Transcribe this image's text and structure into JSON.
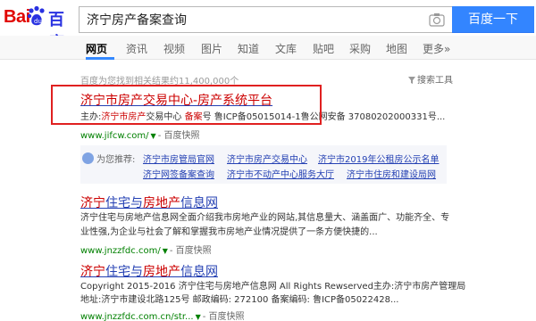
{
  "brand": {
    "logo_left": "Bai",
    "logo_right": "百度"
  },
  "search": {
    "query": "济宁房产备案查询",
    "button": "百度一下"
  },
  "tabs": [
    "网页",
    "资讯",
    "视频",
    "图片",
    "知道",
    "文库",
    "贴吧",
    "采购",
    "地图",
    "更多»"
  ],
  "result_count": "百度为您找到相关结果约11,400,000个",
  "tools": "搜索工具",
  "results": [
    {
      "title_a": "济宁市房产交易中心",
      "title_b": "-房产系统平台",
      "abstract_1_a": "主办:",
      "abstract_1_b": "济宁市房产",
      "abstract_1_c": "交易中心 ",
      "abstract_1_d": "备案",
      "abstract_1_e": "号 鲁ICP备05015014-1鲁公网安备 37080202000331号...",
      "url": "www.jifcw.com/",
      "snapshot": "- 百度快照"
    },
    {
      "title_a": "济宁",
      "title_b": "住宅与",
      "title_c": "房地产",
      "title_d": "信息网",
      "abstract_1": "济宁住宅与房地产信息网全面介绍我市房地产业的网站,其信息量大、涵盖面广、功能齐全、专",
      "abstract_2": "业性强,为企业与社会了解和掌握我市房地产业情况提供了一条方便快捷的...",
      "url": "www.jnzzfdc.com/",
      "snapshot": "- 百度快照"
    },
    {
      "title_a": "济宁",
      "title_b": "住宅与",
      "title_c": "房地产",
      "title_d": "信息网",
      "abstract_1": "Copyright 2015-2016 济宁住宅与房地产信息网 All Rights Rewserved主办:济宁市房产管理局",
      "abstract_2": "地址:济宁市建设北路125号 邮政编码: 272100 备案编码: 鲁ICP备05022428...",
      "url": "www.jnzzfdc.com.cn/str...",
      "snapshot": "- 百度快照"
    }
  ],
  "related": {
    "label": "为您推荐:",
    "links": [
      "济宁市房管局官网",
      "济宁市房产交易中心",
      "济宁市2019年公租房公示名单",
      "济宁网签备案查询",
      "济宁市不动产中心服务大厅",
      "济宁市住房和建设局网"
    ]
  },
  "colors": {
    "link": "#2440b3",
    "highlight": "#c00000",
    "url_green": "#008000",
    "button_blue": "#3385ff",
    "annotation_box": "#e02020"
  }
}
